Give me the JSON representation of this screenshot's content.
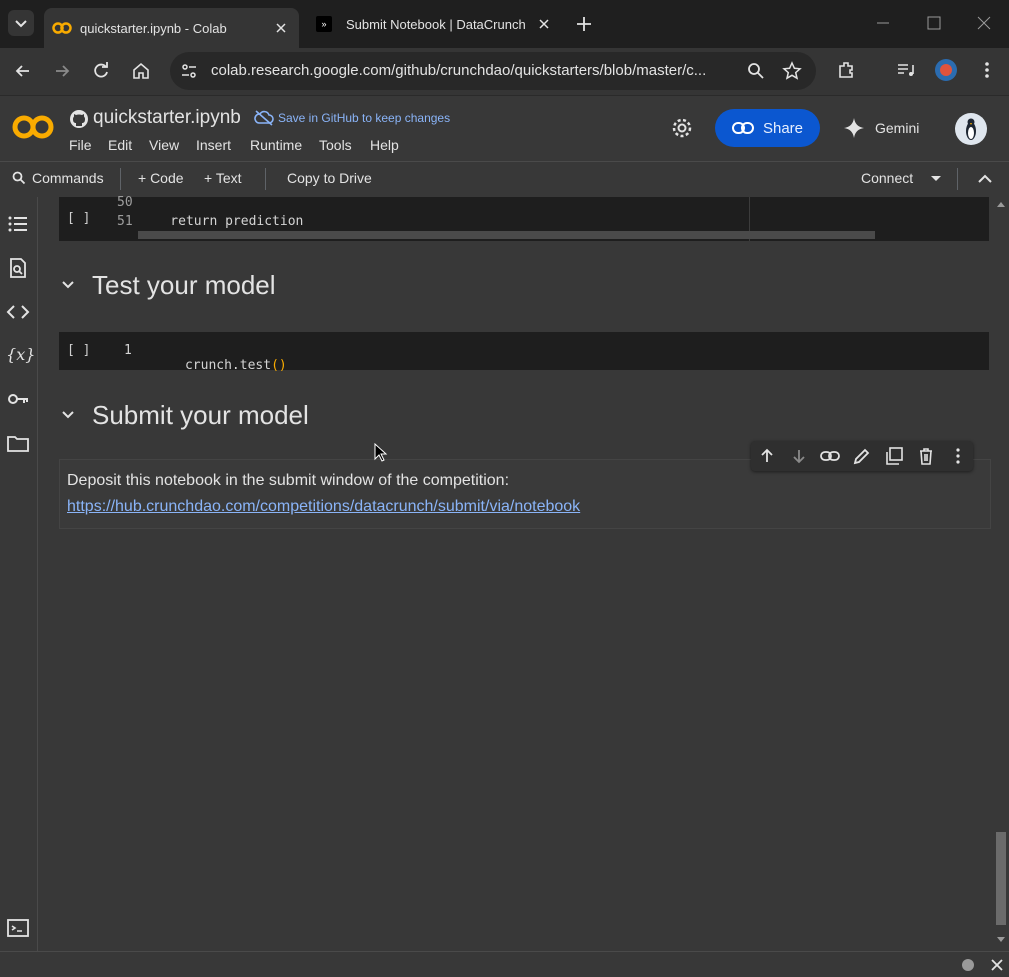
{
  "browser": {
    "tabs": [
      {
        "title": "quickstarter.ipynb - Colab",
        "active": true
      },
      {
        "title": "Submit Notebook | DataCrunch",
        "active": false
      }
    ],
    "url": "colab.research.google.com/github/crunchdao/quickstarters/blob/master/c..."
  },
  "colab": {
    "logo_text": "CO",
    "notebook_name": "quickstarter.ipynb",
    "save_notice": "Save in GitHub to keep changes",
    "menu": [
      "File",
      "Edit",
      "View",
      "Insert",
      "Runtime",
      "Tools",
      "Help"
    ],
    "share_label": "Share",
    "gemini_label": "Gemini",
    "commands_label": "Commands",
    "add_code_label": "+ Code",
    "add_text_label": "+ Text",
    "copy_drive_label": "Copy to Drive",
    "connect_label": "Connect"
  },
  "cells": {
    "cell1": {
      "run_marker": "[ ]",
      "lines": [
        {
          "num": "50",
          "code": ""
        },
        {
          "num": "51",
          "code": "    return prediction"
        }
      ]
    },
    "heading1": "Test your model",
    "cell2": {
      "run_marker": "[ ]",
      "line_num": "1",
      "code_prefix": "crunch.test",
      "code_parens": "()"
    },
    "heading2": "Submit your model",
    "text_cell": {
      "body": "Deposit this notebook in the submit window of the competition:",
      "link": "https://hub.crunchdao.com/competitions/datacrunch/submit/via/notebook"
    }
  },
  "colors": {
    "brand_orange": "#f9ab00",
    "share_blue": "#0b57d0",
    "link_blue": "#8ab4f8"
  }
}
